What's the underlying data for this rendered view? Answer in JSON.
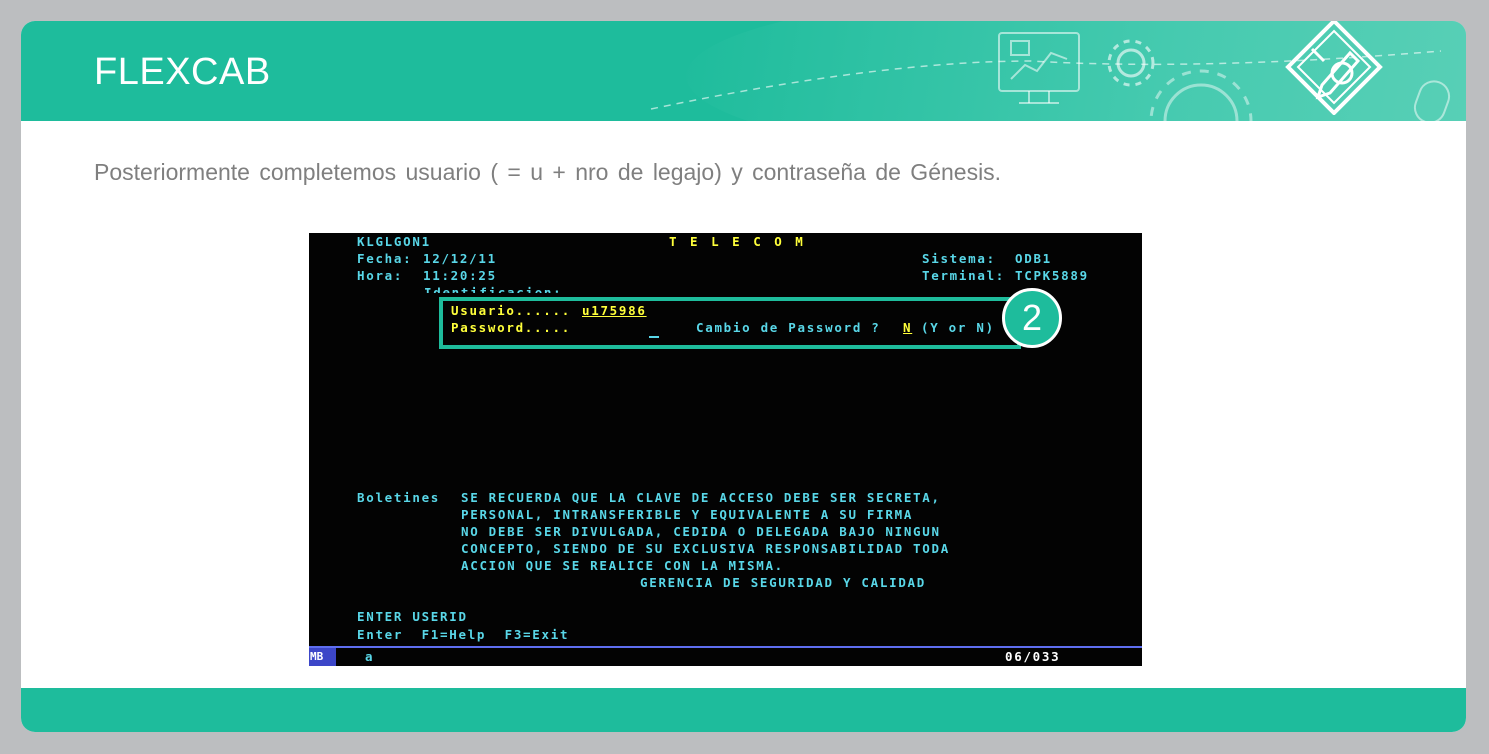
{
  "slide": {
    "title": "FLEXCAB",
    "subtitle": "Posteriormente completemos usuario ( = u + nro de legajo) y contraseña de Génesis.",
    "step_badge": "2"
  },
  "colors": {
    "accent": "#1ebc9c",
    "frame": "#bcbec0",
    "terminal_bg": "#030303",
    "terminal_text": "#59d7e8",
    "terminal_input": "#ffff3a",
    "status_bar": "#5e6ef0"
  },
  "icons": [
    "monitor-chart-icon",
    "gear-icon",
    "large-gear-icon",
    "pencil-diamond-icon",
    "mouse-icon"
  ],
  "terminal": {
    "screen_id": "KLGLGON1",
    "company": "T E L E C O M",
    "fecha_label": "Fecha:",
    "fecha_value": "12/12/11",
    "hora_label": "Hora:",
    "hora_value": "11:20:25",
    "sistema_label": "Sistema:",
    "sistema_value": "ODB1",
    "terminal_label": "Terminal:",
    "terminal_value": "TCPK5889",
    "identificacion": "Identificacion:",
    "usuario_label": "Usuario......",
    "usuario_value": "u175986",
    "password_label": "Password.....",
    "password_value": "",
    "cambio_label": "Cambio de Password ?",
    "cambio_value": "N",
    "cambio_options": "(Y or N)",
    "boletines_label": "Boletines",
    "boletines_lines": [
      "SE RECUERDA QUE LA CLAVE DE ACCESO DEBE SER SECRETA,",
      "PERSONAL, INTRANSFERIBLE Y EQUIVALENTE A SU FIRMA",
      "NO DEBE SER DIVULGADA, CEDIDA O DELEGADA BAJO NINGUN",
      "CONCEPTO, SIENDO DE SU EXCLUSIVA RESPONSABILIDAD TODA",
      "ACCION QUE SE REALICE CON LA MISMA."
    ],
    "boletines_signature": "GERENCIA DE SEGURIDAD Y CALIDAD",
    "prompt": "ENTER USERID",
    "keys": "Enter  F1=Help  F3=Exit",
    "status_mode": "MB",
    "status_indicator": "a",
    "cursor_pos": "06/033"
  }
}
